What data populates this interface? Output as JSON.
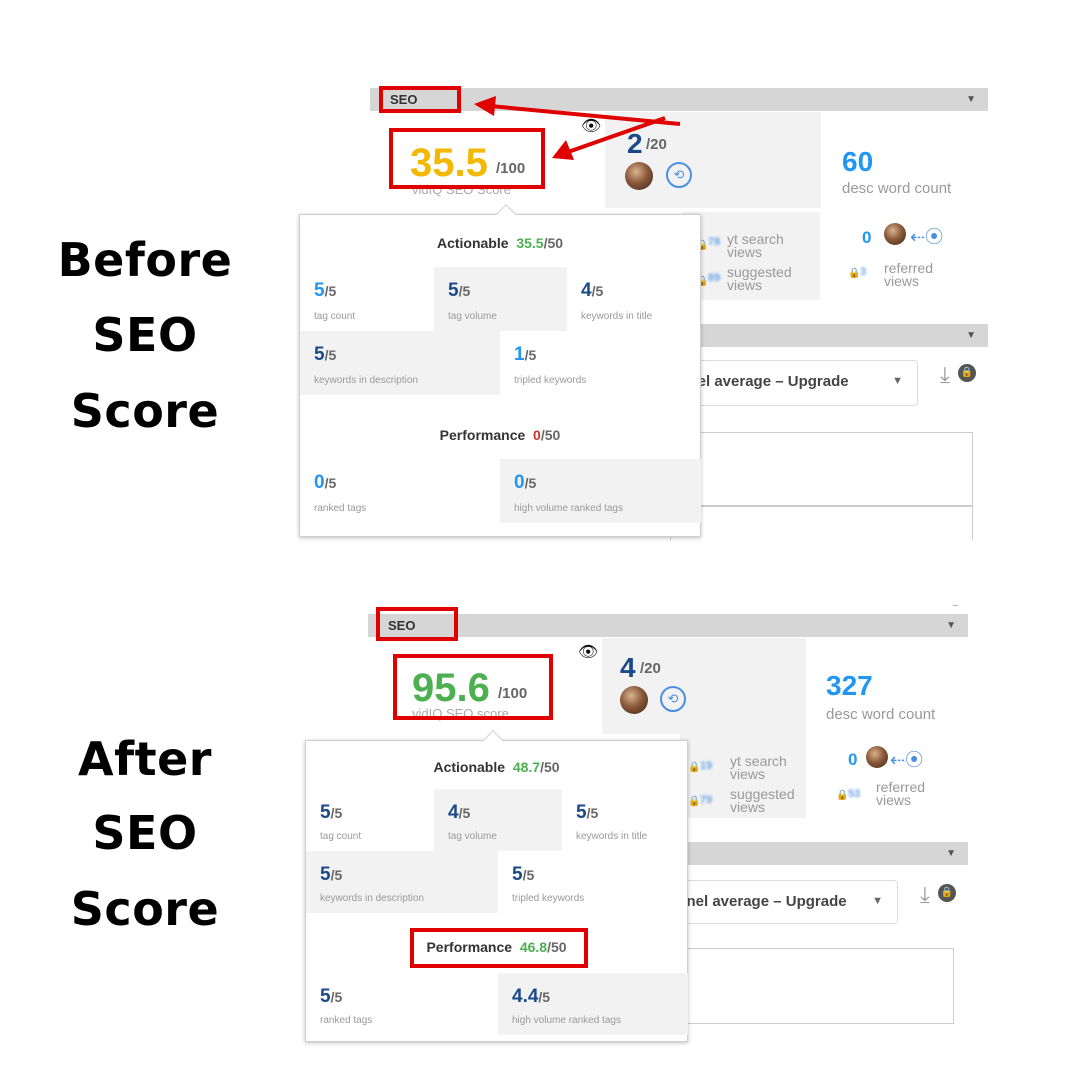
{
  "colors": {
    "accent_red": "#e00000",
    "score_before": "#f5b800",
    "score_after": "#4caf50",
    "blue_value": "#2196f3",
    "dark_blue_value": "#1a4a8a",
    "green_value": "#4caf50",
    "red_value": "#d32f2f"
  },
  "icons": [
    "eye-icon",
    "avatar",
    "cycle-icon",
    "share-icon",
    "lock-icon",
    "download-icon",
    "chevron-down-icon"
  ],
  "before": {
    "label_lines": [
      "Before",
      "SEO",
      "Score"
    ],
    "section_label": "SEO",
    "seo_score": {
      "value": "35.5",
      "max": "/100",
      "label": "vidIQ SEO Score"
    },
    "tags": {
      "value": "2",
      "max": "/20"
    },
    "desc": {
      "value": "60",
      "label": "desc word count"
    },
    "stats": {
      "yt_search": "yt search views",
      "suggested": "suggested views",
      "referred_count": "0",
      "referred": "referred views",
      "yt_search_num": "78",
      "suggested_num": "89",
      "referred_num": "3"
    },
    "select_text": "annel average – Upgrade",
    "popup": {
      "actionable": {
        "label": "Actionable",
        "value": "35.5",
        "max": "/50"
      },
      "cells": [
        {
          "value": "5",
          "max": "/5",
          "label": "tag count"
        },
        {
          "value": "5",
          "max": "/5",
          "label": "tag volume"
        },
        {
          "value": "4",
          "max": "/5",
          "label": "keywords in title"
        },
        {
          "value": "5",
          "max": "/5",
          "label": "keywords in description"
        },
        {
          "value": "1",
          "max": "/5",
          "label": "tripled keywords"
        }
      ],
      "performance": {
        "label": "Performance",
        "value": "0",
        "max": "/50"
      },
      "perf_cells": [
        {
          "value": "0",
          "max": "/5",
          "label": "ranked tags"
        },
        {
          "value": "0",
          "max": "/5",
          "label": "high volume ranked tags"
        }
      ]
    }
  },
  "after": {
    "label_lines": [
      "After",
      "SEO",
      "Score"
    ],
    "section_label": "SEO",
    "seo_score": {
      "value": "95.6",
      "max": "/100",
      "label": "vidIQ SEO score"
    },
    "tags": {
      "value": "4",
      "max": "/20"
    },
    "desc": {
      "value": "327",
      "label": "desc word count"
    },
    "stats": {
      "yt_search": "yt search views",
      "suggested": "suggested views",
      "referred_count": "0",
      "referred": "referred views",
      "yt_search_num": "19",
      "suggested_num": "79",
      "referred_num": "53"
    },
    "select_text": "annel average – Upgrade",
    "popup": {
      "actionable": {
        "label": "Actionable",
        "value": "48.7",
        "max": "/50"
      },
      "cells": [
        {
          "value": "5",
          "max": "/5",
          "label": "tag count"
        },
        {
          "value": "4",
          "max": "/5",
          "label": "tag volume"
        },
        {
          "value": "5",
          "max": "/5",
          "label": "keywords in title"
        },
        {
          "value": "5",
          "max": "/5",
          "label": "keywords in description"
        },
        {
          "value": "5",
          "max": "/5",
          "label": "tripled keywords"
        }
      ],
      "performance": {
        "label": "Performance",
        "value": "46.8",
        "max": "/50"
      },
      "perf_cells": [
        {
          "value": "5",
          "max": "/5",
          "label": "ranked tags"
        },
        {
          "value": "4.4",
          "max": "/5",
          "label": "high volume ranked tags"
        }
      ]
    }
  }
}
